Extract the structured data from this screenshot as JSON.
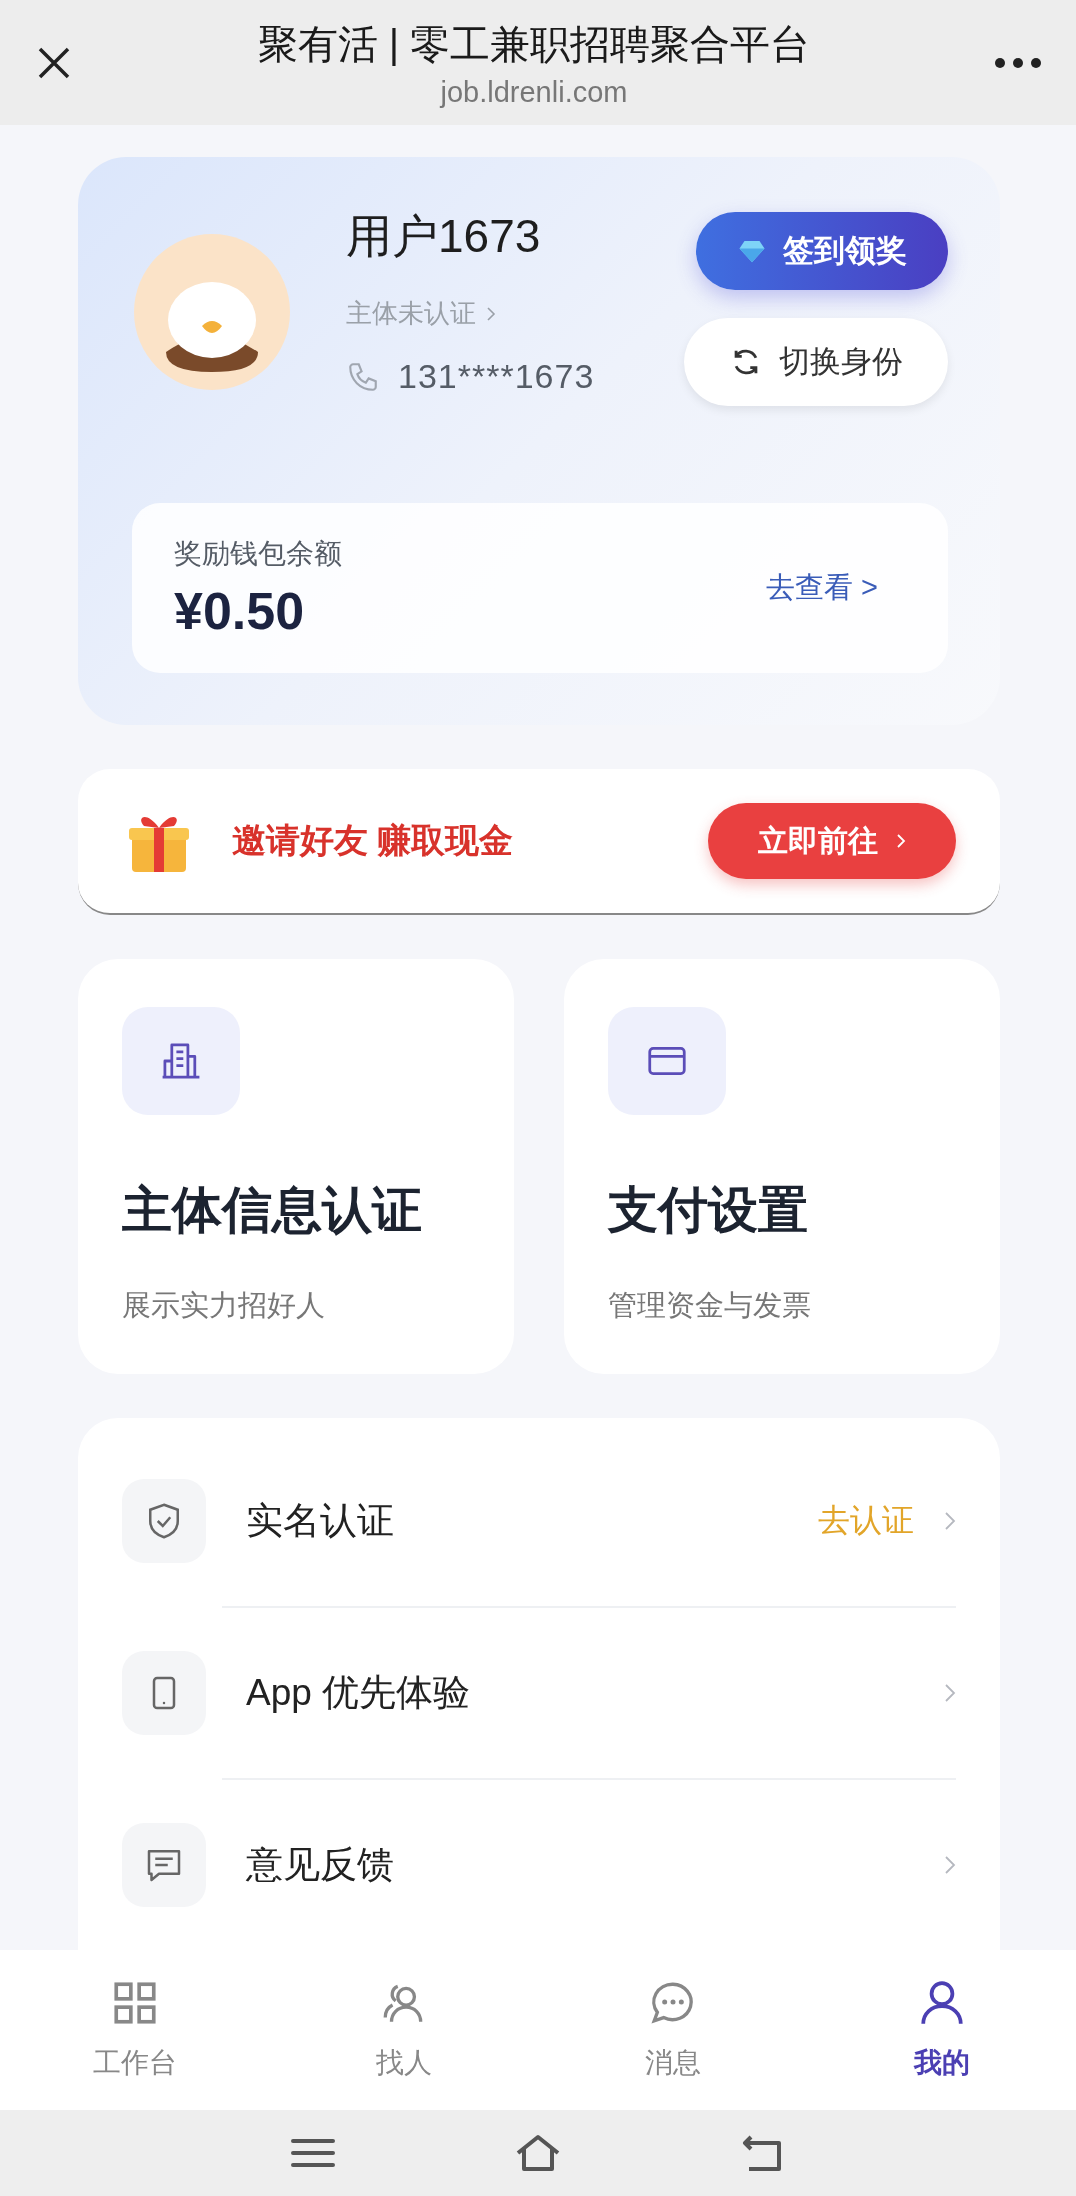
{
  "header": {
    "title": "聚有活 | 零工兼职招聘聚合平台",
    "url": "job.ldrenli.com"
  },
  "profile": {
    "name": "用户1673",
    "verification": "主体未认证",
    "phone": "131****1673",
    "checkin_button": "签到领奖",
    "switch_button": "切换身份"
  },
  "wallet": {
    "label": "奖励钱包余额",
    "amount": "¥0.50",
    "link": "去查看 >"
  },
  "invite": {
    "text": "邀请好友 赚取现金",
    "button": "立即前往"
  },
  "feature_cards": [
    {
      "kind": "building",
      "title": "主体信息认证",
      "subtitle": "展示实力招好人"
    },
    {
      "kind": "card",
      "title": "支付设置",
      "subtitle": "管理资金与发票"
    }
  ],
  "menu": [
    {
      "kind": "shield",
      "label": "实名认证",
      "status": "去认证"
    },
    {
      "kind": "phone",
      "label": "App 优先体验"
    },
    {
      "kind": "feedback",
      "label": "意见反馈"
    }
  ],
  "tabs": [
    {
      "kind": "grid",
      "label": "工作台",
      "selected": false
    },
    {
      "kind": "people",
      "label": "找人",
      "selected": false
    },
    {
      "kind": "chat",
      "label": "消息",
      "selected": false
    },
    {
      "kind": "person",
      "label": "我的",
      "selected": true
    }
  ]
}
